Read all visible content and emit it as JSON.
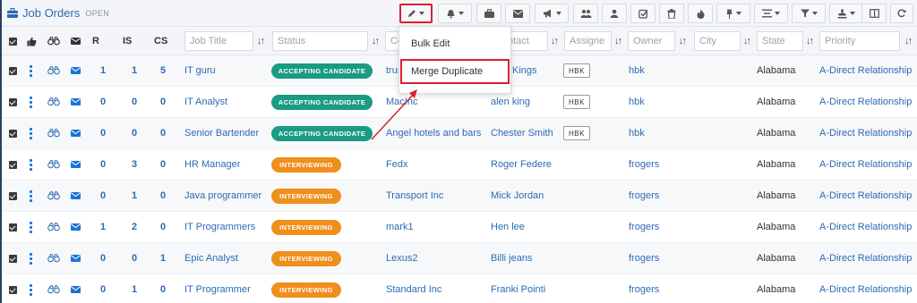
{
  "app": {
    "title": "Job Orders",
    "subtitle": "OPEN"
  },
  "toolbar": {
    "buttons": [
      {
        "icon": "pencil-icon",
        "dropdown": true,
        "highlighted": true
      },
      {
        "icon": "bell-icon",
        "dropdown": true
      },
      {
        "icon": "briefcase-icon",
        "dropdown": false
      },
      {
        "icon": "envelope-icon",
        "dropdown": false
      },
      {
        "icon": "bullhorn-icon",
        "dropdown": true
      },
      {
        "icon": "users-icon",
        "dropdown": false
      },
      {
        "icon": "user-icon",
        "dropdown": false
      },
      {
        "icon": "check-square-icon",
        "dropdown": false
      },
      {
        "icon": "trash-icon",
        "dropdown": false
      },
      {
        "icon": "fire-icon",
        "dropdown": false
      },
      {
        "icon": "pushpin-icon",
        "dropdown": true
      },
      {
        "icon": "align-icon",
        "dropdown": true
      },
      {
        "icon": "filter-icon",
        "dropdown": true
      },
      {
        "icon": "stamp-icon",
        "dropdown": true
      },
      {
        "icon": "columns-icon",
        "dropdown": false
      },
      {
        "icon": "refresh-icon",
        "dropdown": false
      }
    ]
  },
  "edit_menu": {
    "items": [
      "Bulk Edit",
      "Merge Duplicate"
    ],
    "highlighted": "Merge Duplicate"
  },
  "columns": {
    "r": "R",
    "is": "IS",
    "cs": "CS",
    "job_title_placeholder": "Job Title",
    "status_placeholder": "Status",
    "company_placeholder": "Co",
    "contact_placeholder": "ntact",
    "assignee_placeholder": "Assigne",
    "owner_placeholder": "Owner",
    "city_placeholder": "City",
    "state_placeholder": "State",
    "priority_placeholder": "Priority",
    "sort_glyph": "↓↑"
  },
  "rows": [
    {
      "r": "1",
      "is": "1",
      "cs": "5",
      "job_title": "IT guru",
      "status": "ACCEPTING CANDIDATE",
      "status_color": "#1a9b82",
      "company": "trus",
      "contact": "Kings",
      "assignee": "HBK",
      "owner": "hbk",
      "city": "",
      "state": "Alabama",
      "priority": "A-Direct Relationship"
    },
    {
      "r": "0",
      "is": "0",
      "cs": "0",
      "job_title": "IT Analyst",
      "status": "ACCEPTING CANDIDATE",
      "status_color": "#1a9b82",
      "company": "MacInc",
      "contact": "alen king",
      "assignee": "HBK",
      "owner": "hbk",
      "city": "",
      "state": "Alabama",
      "priority": "A-Direct Relationship"
    },
    {
      "r": "0",
      "is": "0",
      "cs": "0",
      "job_title": "Senior Bartender",
      "status": "ACCEPTING CANDIDATE",
      "status_color": "#1a9b82",
      "company": "Angel hotels and bars",
      "contact": "Chester Smith",
      "assignee": "HBK",
      "owner": "hbk",
      "city": "",
      "state": "Alabama",
      "priority": "A-Direct Relationship"
    },
    {
      "r": "0",
      "is": "3",
      "cs": "0",
      "job_title": "HR Manager",
      "status": "INTERVIEWING",
      "status_color": "#ef8f1c",
      "company": "Fedx",
      "contact": "Roger Federe",
      "assignee": "",
      "owner": "frogers",
      "city": "",
      "state": "Alabama",
      "priority": "A-Direct Relationship"
    },
    {
      "r": "0",
      "is": "1",
      "cs": "0",
      "job_title": "Java programmer",
      "status": "INTERVIEWING",
      "status_color": "#ef8f1c",
      "company": "Transport Inc",
      "contact": "Mick Jordan",
      "assignee": "",
      "owner": "frogers",
      "city": "",
      "state": "Alabama",
      "priority": "A-Direct Relationship"
    },
    {
      "r": "1",
      "is": "2",
      "cs": "0",
      "job_title": "IT Programmers",
      "status": "INTERVIEWING",
      "status_color": "#ef8f1c",
      "company": "mark1",
      "contact": "Hen lee",
      "assignee": "",
      "owner": "frogers",
      "city": "",
      "state": "Alabama",
      "priority": "A-Direct Relationship"
    },
    {
      "r": "0",
      "is": "0",
      "cs": "1",
      "job_title": "Epic Analyst",
      "status": "INTERVIEWING",
      "status_color": "#ef8f1c",
      "company": "Lexus2",
      "contact": "Billi jeans",
      "assignee": "",
      "owner": "frogers",
      "city": "",
      "state": "Alabama",
      "priority": "A-Direct Relationship"
    },
    {
      "r": "0",
      "is": "1",
      "cs": "0",
      "job_title": "IT Programmer",
      "status": "INTERVIEWING",
      "status_color": "#ef8f1c",
      "company": "Standard Inc",
      "contact": "Franki Pointi",
      "assignee": "",
      "owner": "frogers",
      "city": "",
      "state": "Alabama",
      "priority": "A-Direct Relationship"
    }
  ],
  "colors": {
    "accent": "#2d6ab3",
    "highlight": "#d9202f",
    "green": "#1a9b82",
    "orange": "#ef8f1c"
  }
}
